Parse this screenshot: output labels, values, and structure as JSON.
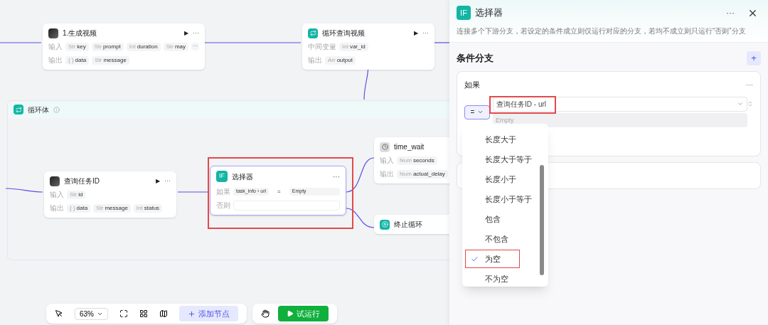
{
  "canvas": {
    "nodes": [
      {
        "kind": "task",
        "title": "1.生成视频",
        "run": "▶",
        "more": "···",
        "rows": [
          {
            "label": "输入",
            "params": [
              {
                "type": "Str",
                "name": "key"
              },
              {
                "type": "Str",
                "name": "prompt"
              },
              {
                "type": "Int",
                "name": "duration"
              },
              {
                "type": "Str",
                "name": "may"
              }
            ],
            "overflow": "···"
          },
          {
            "label": "输出",
            "params": [
              {
                "type": "{ }",
                "name": "data"
              },
              {
                "type": "Str",
                "name": "message"
              }
            ]
          }
        ]
      },
      {
        "kind": "loop",
        "title": "循环查询视频",
        "run": "▶",
        "more": "···",
        "rows": [
          {
            "label": "中间变量",
            "params": [
              {
                "type": "Int",
                "name": "var_id"
              }
            ]
          },
          {
            "label": "输出",
            "params": [
              {
                "type": "Arr",
                "name": "output"
              }
            ]
          }
        ]
      },
      {
        "kind": "task",
        "title": "查询任务ID",
        "run": "▶",
        "more": "···",
        "rows": [
          {
            "label": "输入",
            "params": [
              {
                "type": "Str",
                "name": "id"
              }
            ]
          },
          {
            "label": "输出",
            "params": [
              {
                "type": "{ }",
                "name": "data"
              },
              {
                "type": "Str",
                "name": "message"
              },
              {
                "type": "Int",
                "name": "status"
              }
            ]
          }
        ]
      },
      {
        "kind": "selector",
        "icon": "IF",
        "title": "选择器",
        "more": "···",
        "if_label": "如果",
        "left": "task_info",
        "separator": "›",
        "left_field": "url",
        "operator": "=",
        "right": "Empty",
        "else_label": "否则"
      },
      {
        "kind": "plugin",
        "title": "time_wait",
        "rows": [
          {
            "label": "输入",
            "params": [
              {
                "type": "Num",
                "name": "seconds"
              }
            ]
          },
          {
            "label": "输出",
            "params": [
              {
                "type": "Num",
                "name": "actual_delay"
              }
            ]
          }
        ]
      },
      {
        "kind": "end",
        "title": "终止循环"
      }
    ],
    "loop_body": {
      "title": "循环体"
    }
  },
  "panel": {
    "icon": "IF",
    "title": "选择器",
    "more": "···",
    "description": "连接多个下游分支，若设定的条件成立则仅运行对应的分支，若均不成立则只运行“否则”分支",
    "section": "条件分支",
    "add": "+",
    "branch": {
      "label": "如果",
      "collapse": "—",
      "operator": "=",
      "field": "查询任务ID - url",
      "placeholder": "Empty"
    },
    "options": [
      {
        "label": "长度大于",
        "selected": false
      },
      {
        "label": "长度大于等于",
        "selected": false
      },
      {
        "label": "长度小于",
        "selected": false
      },
      {
        "label": "长度小于等于",
        "selected": false
      },
      {
        "label": "包含",
        "selected": false
      },
      {
        "label": "不包含",
        "selected": false
      },
      {
        "label": "为空",
        "selected": true
      },
      {
        "label": "不为空",
        "selected": false
      }
    ]
  },
  "toolbar": {
    "zoom": "63%",
    "add_node": "添加节点",
    "run": "试运行"
  }
}
